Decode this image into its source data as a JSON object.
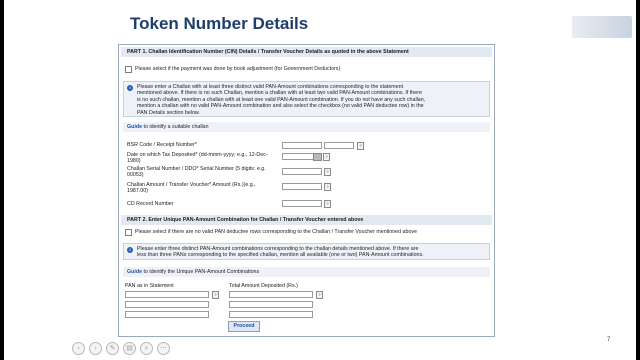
{
  "slide": {
    "title": "Token Number Details",
    "page_number": "7"
  },
  "part1": {
    "header": "PART 1. Challan Identification Number (CIN) Details / Transfer Voucher Details as quoted in the above Statement",
    "book_adjustment_label": "Please select if the payment was done by book adjustment (for Government Deductors)",
    "info_lines": [
      "Please enter a Challan with at least three distinct valid PAN-Amount combinations corresponding to the statement",
      "mentioned above. If there is no such Challan, mention a challan with at least two valid PAN-Amount combinations. If there",
      "is no such challan, mention a challan with at least one valid PAN-Amount combination. If you do not have any such challan,",
      "mention a challan with no valid PAN-Amount combination and also select the checkbox (no valid PAN deductee row) in the",
      "PAN Details section below."
    ],
    "guide_link": "Guide",
    "guide_text": "to identify a suitable challan",
    "fields": [
      {
        "label": "BSR Code / Receipt Number*"
      },
      {
        "label": "Date on which Tax Deposited* (dd-mmm-yyyy; e.g., 12-Dec-1980)"
      },
      {
        "label": "Challan Serial Number / DDO* Serial Number (5 digits: e.g. 00053)"
      },
      {
        "label": "Challan Amount / Transfer Voucher* Amount (Rs.)(e.g., 1987.00)"
      },
      {
        "label": "CD Record Number"
      }
    ]
  },
  "part2": {
    "header": "PART 2. Enter Unique PAN-Amount Combination for Challan / Transfer Voucher entered above",
    "no_valid_pan_label": "Please select if there are no valid PAN deductee rows corresponding to the Challan / Transfer Voucher mentioned above",
    "info_lines": [
      "Please enter three distinct PAN-Amount combinations corresponding to the challan details mentioned above. If there are",
      "less than three PANs corresponding to the specified challan, mention all available (one or two) PAN-Amount combinations."
    ],
    "guide_link": "Guide",
    "guide_text": "to identify the Unique PAN-Amount Combinations",
    "col_pan": "PAN as in Statement",
    "col_amount": "Total Amount Deposited (Rs.)",
    "proceed_label": "Proceed"
  },
  "nav": {
    "buttons": [
      "‹",
      "›",
      "✎",
      "▤",
      "⌕",
      "⋯"
    ]
  }
}
